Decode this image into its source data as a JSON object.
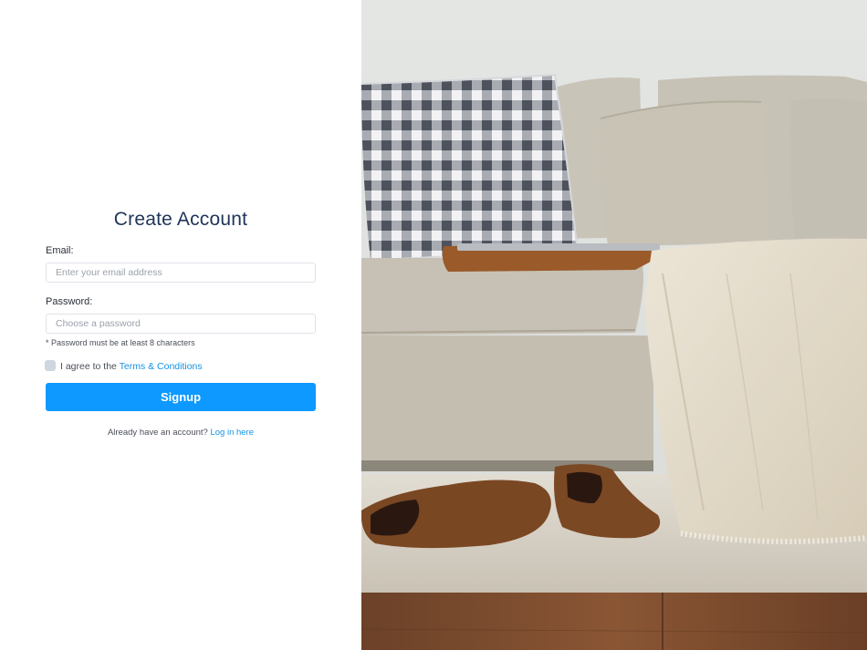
{
  "form": {
    "title": "Create Account",
    "email_label": "Email:",
    "email_placeholder": "Enter your email address",
    "email_value": "",
    "password_label": "Password:",
    "password_placeholder": "Choose a password",
    "password_value": "",
    "password_hint": "* Password must be at least 8 characters",
    "agree_prefix": "I agree to the ",
    "terms_link": "Terms & Conditions",
    "submit_label": "Signup",
    "login_prompt": "Already have an account?",
    "login_link": "Log in here"
  },
  "colors": {
    "accent": "#0d99ff",
    "link": "#1592e6",
    "title": "#1f3558"
  }
}
